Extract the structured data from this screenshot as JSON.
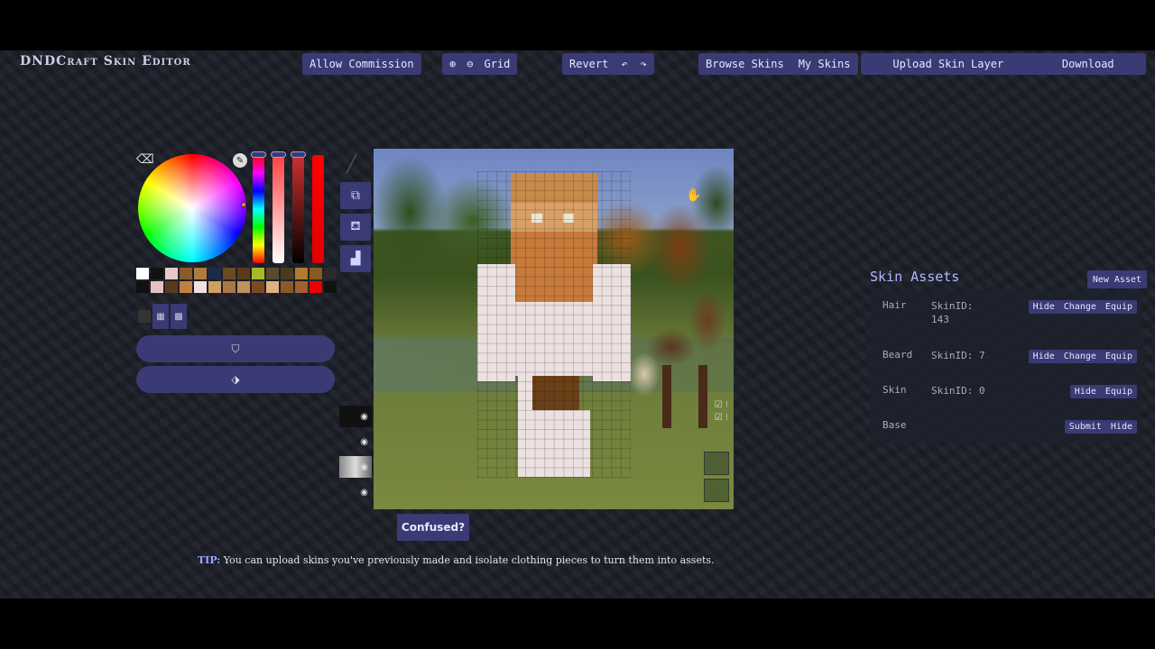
{
  "app": {
    "title": "DNDCraft Skin Editor"
  },
  "toolbar": {
    "allow_commission": "Allow Commission",
    "grid": "Grid",
    "revert": "Revert",
    "browse_skins": "Browse Skins",
    "my_skins": "My Skins",
    "upload_skin_layer": "Upload Skin Layer",
    "download": "Download"
  },
  "palette": {
    "row1": [
      "#ffffff",
      "#111111",
      "#e9c8cc",
      "#8a5a2a",
      "#b07a3a",
      "#1d2a4a",
      "#6b4a20",
      "#5a3a1a",
      "#a8b828",
      "#5a4a30",
      "#4a3a20",
      "#b07a30",
      "#8a5a20",
      "#2a2a2a"
    ],
    "row2": [
      "#111111",
      "#e8c0c0",
      "#5a3a1a",
      "#c08040",
      "#f0e0e0",
      "#d0a060",
      "#a87848",
      "#c09060",
      "#7a4a20",
      "#e0b080",
      "#8a5a2a",
      "#a06030",
      "#ee0000",
      "#111111"
    ]
  },
  "assets": {
    "title": "Skin Assets",
    "new_asset": "New Asset",
    "items": [
      {
        "name": "Hair",
        "skin_id": "SkinID: 143",
        "buttons": [
          "Hide",
          "Change",
          "Equip"
        ]
      },
      {
        "name": "Beard",
        "skin_id": "SkinID: 7",
        "buttons": [
          "Hide",
          "Change",
          "Equip"
        ]
      },
      {
        "name": "Skin",
        "skin_id": "SkinID: 0",
        "buttons": [
          "Hide",
          "Equip"
        ]
      },
      {
        "name": "Base",
        "skin_id": "",
        "buttons": [
          "Submit",
          "Hide"
        ]
      }
    ]
  },
  "help": {
    "confused": "Confused?",
    "tip_label": "TIP:",
    "tip_text": " You can upload skins you've previously made and isolate clothing pieces to turn them into assets."
  },
  "icons": {
    "eraser": "eraser-icon",
    "eyedropper": "eyedropper-icon",
    "zoom_in": "zoom-in-icon",
    "zoom_out": "zoom-out-icon",
    "undo": "undo-icon",
    "redo": "redo-icon",
    "select": "select-icon",
    "fill": "fill-bucket-icon",
    "chart": "chart-icon",
    "eye": "eye-icon",
    "shield": "shield-icon",
    "arrows": "arrows-icon"
  },
  "colors": {
    "accent": "#3a3a75",
    "title": "#aeb8ff",
    "background": "#1b1e26"
  }
}
